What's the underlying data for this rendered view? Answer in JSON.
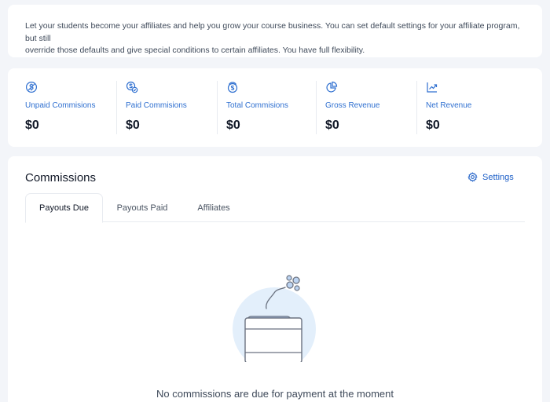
{
  "intro": {
    "line1": "Let your students become your affiliates and help you grow your course business. You can set default settings for your affiliate program, but still",
    "line2": "override those defaults and give special conditions to certain affiliates. You have full flexibility."
  },
  "stats": [
    {
      "icon": "dollar-slash-icon",
      "label": "Unpaid Commisions",
      "value": "$0"
    },
    {
      "icon": "dollar-check-icon",
      "label": "Paid Commisions",
      "value": "$0"
    },
    {
      "icon": "coins-stack-icon",
      "label": "Total Commisions",
      "value": "$0"
    },
    {
      "icon": "pie-chart-icon",
      "label": "Gross Revenue",
      "value": "$0"
    },
    {
      "icon": "trend-up-icon",
      "label": "Net Revenue",
      "value": "$0"
    }
  ],
  "commissions": {
    "title": "Commissions",
    "settings_label": "Settings",
    "tabs": [
      "Payouts Due",
      "Payouts Paid",
      "Affiliates"
    ],
    "empty_message": "No commissions are due for payment at the moment"
  },
  "colors": {
    "accent": "#1d5fc7",
    "background": "#f3f5f9",
    "illustration_circle": "#e3effb"
  }
}
